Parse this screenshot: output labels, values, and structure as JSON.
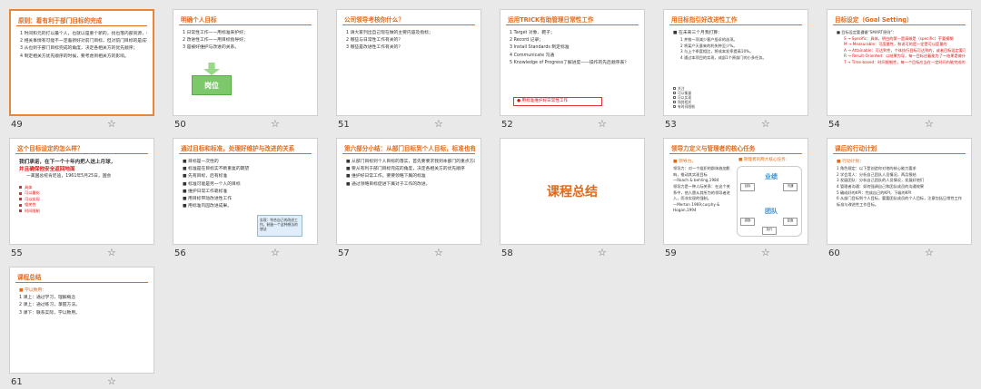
{
  "slides": [
    {
      "number": "49",
      "selected": true,
      "title": "原则：着有利于部门目标的完成",
      "lines": [
        "1 时间和元的打以最个人，也就以是重个新的，找也落内部资源，也打以也落外部资源；",
        "2 相关事情有可能不一定着新好对前门目标，但对前门目标的是成有促进作用。",
        "3 从也到于部门目标完成的角度，决定各相关方的优先顺序；",
        "4 制定相关方优先顺序的时候，要考虑到相关方的影响。"
      ]
    },
    {
      "number": "50",
      "title": "明确个人目标",
      "lines": [
        "1 日常性工作——用标准来护好；",
        "2 改进性工作——用目标指导好；",
        "3 是被好维护与改进的关系。"
      ],
      "badge": "岗位"
    },
    {
      "number": "51",
      "title": "公司领导考核你什么？",
      "lines": [
        "1 请大家列出自己现在做的主要内容及指标；",
        "2 哪些与日常性工作有关的？",
        "3 哪些是改进性工作有关的？"
      ]
    },
    {
      "number": "52",
      "title": "运用TRICK有助管理日常性工作",
      "lines": [
        "1 Target 对象、靶子；",
        "2 Record 记录；",
        "3 Install Standards 制定标准",
        "4 Communicate 沟通",
        "5 Knowledge of Progress了解进度——操作的先后顺序表？"
      ],
      "button": "用标准维护好日常性工作"
    },
    {
      "number": "53",
      "title": "用目标指引好改进性工作",
      "lines": [
        "■ 在未来三个月我打算：",
        "1 并推一项减少客户投诉的选项。",
        "2 将某产天意来的利失种至少%。",
        "3 与上个季度相比，将成本发率提高10%。",
        "4 通过本项目的实现，成部1个原部门的小多任务。"
      ],
      "checks": [
        "关注",
        "可以衡量",
        "可以实现",
        "和其相关",
        "有时间限制"
      ]
    },
    {
      "number": "54",
      "title": "目标设定（Goal Setting）",
      "lines": [
        "■ 目标设定要遵循“SMART原则”：",
        "S → Specific：具体，明白的第一是清晰是（specific）不要模糊",
        "M → Measurable：可度量性，和说可的是一定是可以度量的",
        "A → Attainable：可达到性，个体执行目标可达到的，或者目标设定要可以付出达到",
        "R → Result-Oriented：以结果为导，每一目标应着能为了一结果是做什么",
        "T → Time-based：时间限制性，每一个目标应当在一定时间内能完成的"
      ]
    },
    {
      "number": "55",
      "title": "这个目标设定的怎么样？",
      "dark": true,
      "lines": [
        "我们承诺，在下一个十年内把人送上月球，",
        "并且确保他安全返回地面",
        "—美国总统肯尼迪，1961年5月25日，国会"
      ],
      "items": [
        "具体",
        "可以量化",
        "可以实现",
        "相关性",
        "时间限制"
      ]
    },
    {
      "number": "56",
      "title": "通过目标和标准，处理好维护与改进的关系",
      "lines": [
        "■ 目标是一次性的",
        "■ 标准是在目标实不断重复的期望",
        "■ 先有目标，后有标准",
        "■ 标准可能是另一个人的目标",
        "■ 维护日常工作靠标准",
        "■ 用目标带动改进性工作",
        "■ 用标准巩固改进成果。"
      ],
      "callout": "实现：符合自己的改进工作，制造一个这种想法的想法"
    },
    {
      "number": "57",
      "title": "第六部分小结：从部门目标到个人目标，标准也有与改进",
      "lines": [
        "■ 从部门目标到个人目标的落实，首先要要求我到本部门的重点方向",
        "■ 要从有利于部门目标完成的角度，决定各相关方的优先顺序",
        "■ 维护好日常工作，要要领略下属的标准",
        "■ 通过领略目标促进下属对于工作的改进。"
      ]
    },
    {
      "number": "58",
      "big": "课程总结"
    },
    {
      "number": "59",
      "title": "领导力定义与管理者的核心任务",
      "lines": [
        "■ 领导力。",
        "领导力：对一个组织的群体施加影响，推动其实现目标",
        "—Roach & behling,1984",
        "领导力是一种人际关系：在这个关系中，他人愿从其所为的领导者进入，而非实现的强制。",
        "—Merton 1969;curphy & Hogan,1994"
      ],
      "core": "■ 管理者的两大核心任务：",
      "cycle": [
        "业绩",
        "团队",
        "目标",
        "沟通",
        "激励",
        "复盘",
        "执行"
      ]
    },
    {
      "number": "60",
      "title": "课后的行动计划",
      "lines": [
        "■ 行动计划：",
        "1 角色规定：以下是创造你对他的核心能力要求",
        "2 学会用人：分析自己团队人员情况，两月报结",
        "3 发展团队：分析自己团队的人员情况，发展好他们",
        "4 管理者沟通：如何强调自己和团队成员的沟通效果",
        "5 确成好的KPI：完成自己的KPI，下级的KPI",
        "6 从部门目标到个人目标，要要团队成员的个人目标，注意包括日常性工作标准与改进性工作目标。"
      ]
    },
    {
      "number": "61",
      "title": "课程总结",
      "lines": [
        "■ 学以致用：",
        "1 课上：通过学习，理解概念",
        "2 课上：通过练习，掌握方法。",
        "3 课下：联系实际，学以致用。"
      ]
    }
  ]
}
